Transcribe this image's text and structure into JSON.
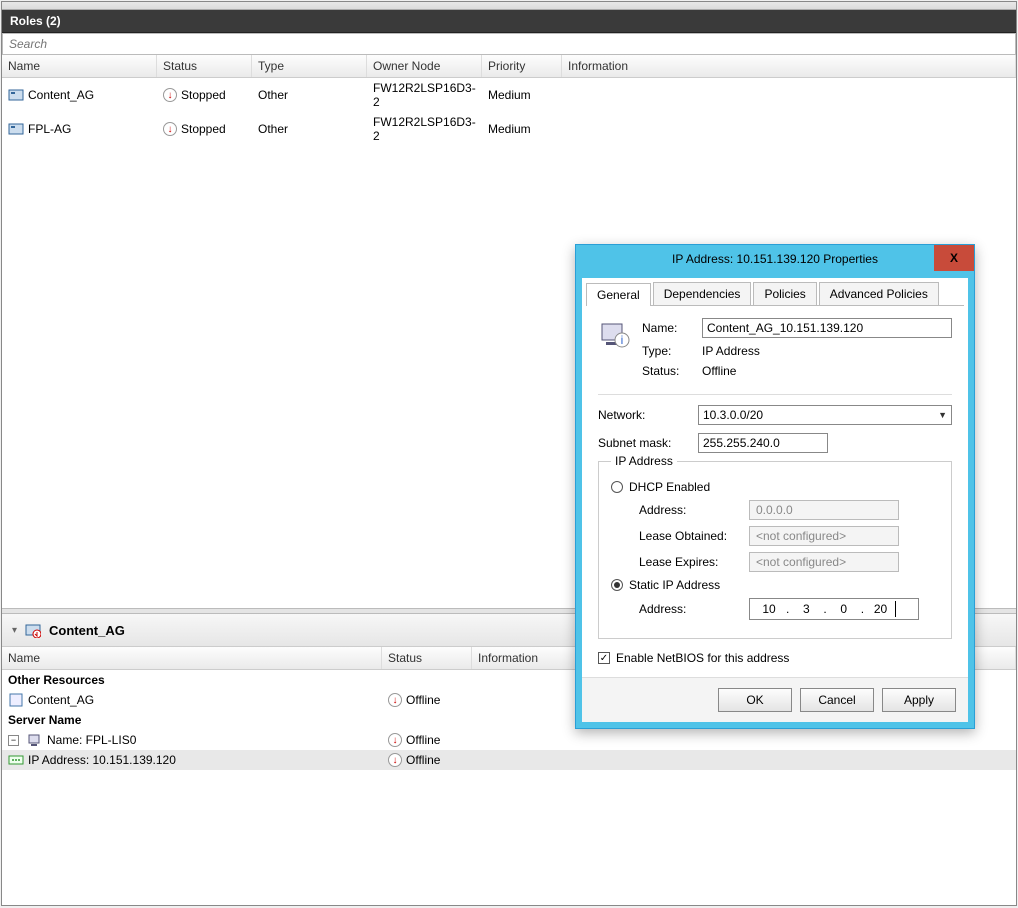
{
  "header": {
    "title": "Roles (2)"
  },
  "search": {
    "placeholder": "Search"
  },
  "columns": {
    "name": "Name",
    "status": "Status",
    "type": "Type",
    "owner": "Owner Node",
    "priority": "Priority",
    "info": "Information"
  },
  "roles": [
    {
      "name": "Content_AG",
      "status": "Stopped",
      "type": "Other",
      "owner": "FW12R2LSP16D3-2",
      "priority": "Medium"
    },
    {
      "name": "FPL-AG",
      "status": "Stopped",
      "type": "Other",
      "owner": "FW12R2LSP16D3-2",
      "priority": "Medium"
    }
  ],
  "detail": {
    "title": "Content_AG",
    "columns": {
      "name": "Name",
      "status": "Status",
      "info": "Information"
    },
    "groups": {
      "other": {
        "label": "Other Resources",
        "items": [
          {
            "name": "Content_AG",
            "status": "Offline"
          }
        ]
      },
      "server": {
        "label": "Server Name",
        "node": {
          "label": "Name: FPL-LIS0",
          "status": "Offline",
          "children": [
            {
              "label": "IP Address: 10.151.139.120",
              "status": "Offline"
            }
          ]
        }
      }
    }
  },
  "dialog": {
    "title": "IP Address: 10.151.139.120 Properties",
    "tabs": {
      "general": "General",
      "dependencies": "Dependencies",
      "policies": "Policies",
      "advanced": "Advanced Policies"
    },
    "labels": {
      "name": "Name:",
      "type": "Type:",
      "status": "Status:",
      "network": "Network:",
      "subnet": "Subnet mask:",
      "ipaddr_group": "IP Address",
      "dhcp": "DHCP Enabled",
      "address": "Address:",
      "lease_obtained": "Lease Obtained:",
      "lease_expires": "Lease Expires:",
      "static": "Static IP Address",
      "netbios": "Enable NetBIOS for this address"
    },
    "values": {
      "name": "Content_AG_10.151.139.120",
      "type": "IP Address",
      "status": "Offline",
      "network": "10.3.0.0/20",
      "subnet": "255.255.240.0",
      "dhcp_address": "0.0.0.0",
      "not_configured": "<not configured>",
      "ip": [
        "10",
        "3",
        "0",
        "20"
      ]
    },
    "buttons": {
      "ok": "OK",
      "cancel": "Cancel",
      "apply": "Apply"
    }
  }
}
